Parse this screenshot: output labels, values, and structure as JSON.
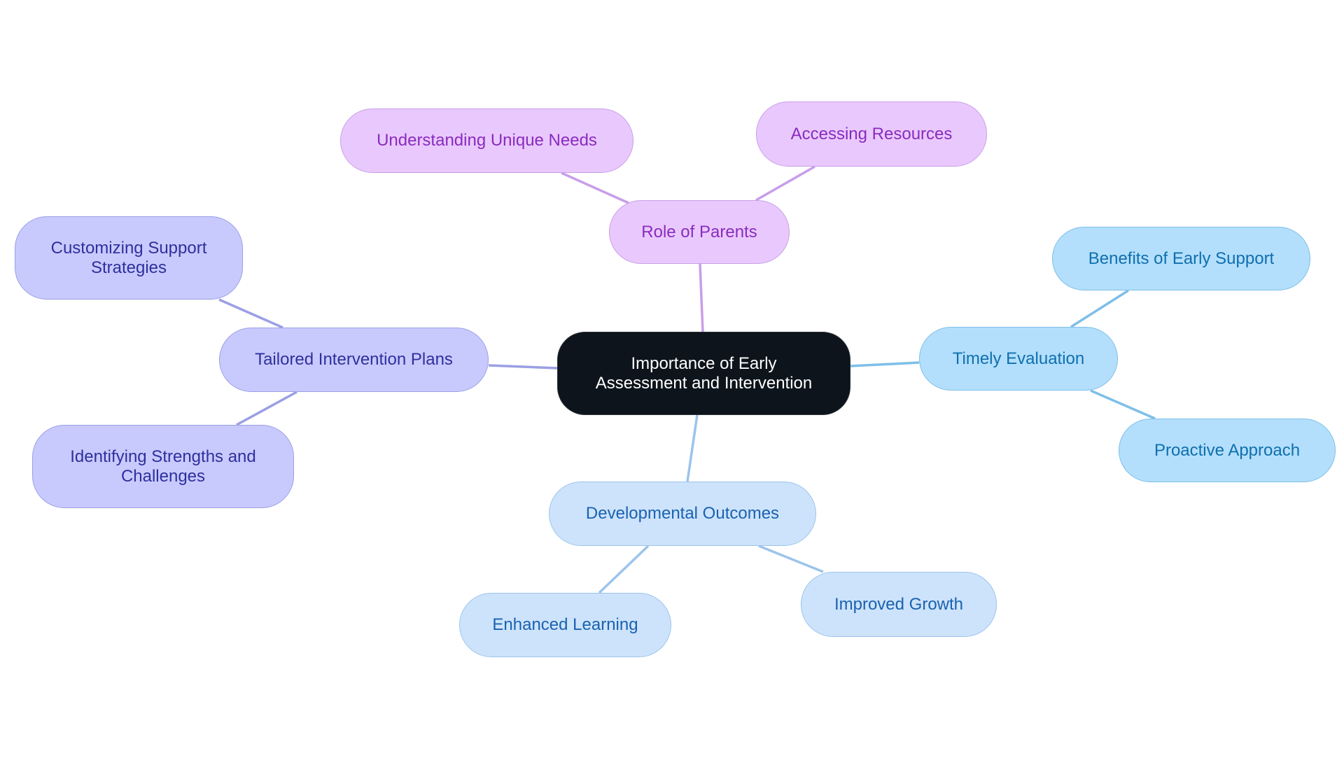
{
  "diagram": {
    "type": "mindmap",
    "root": {
      "id": "root",
      "label": "Importance of Early\nAssessment and Intervention",
      "colors": {
        "fill": "#0d141b",
        "border": "#2b3138",
        "text": "#ffffff"
      }
    },
    "branches": [
      {
        "id": "parents",
        "label": "Role of Parents",
        "colors": {
          "fill": "#e9c9fd",
          "border": "#c89ee9",
          "text": "#8a2bbf",
          "edge": "#c89ee9"
        },
        "children": [
          {
            "id": "unique-needs",
            "label": "Understanding Unique Needs"
          },
          {
            "id": "resources",
            "label": "Accessing Resources"
          }
        ]
      },
      {
        "id": "tailored",
        "label": "Tailored Intervention Plans",
        "colors": {
          "fill": "#c8cafd",
          "border": "#9a9fe4",
          "text": "#2f2f9e",
          "edge": "#9a9fe4"
        },
        "children": [
          {
            "id": "customizing",
            "label": "Customizing Support\nStrategies"
          },
          {
            "id": "strengths",
            "label": "Identifying Strengths and\nChallenges"
          }
        ]
      },
      {
        "id": "timely",
        "label": "Timely Evaluation",
        "colors": {
          "fill": "#b3dffc",
          "border": "#7ebfe8",
          "text": "#0f6fae",
          "edge": "#7ebfe8"
        },
        "children": [
          {
            "id": "benefits",
            "label": "Benefits of Early Support"
          },
          {
            "id": "proactive",
            "label": "Proactive Approach"
          }
        ]
      },
      {
        "id": "developmental",
        "label": "Developmental Outcomes",
        "colors": {
          "fill": "#cde3fb",
          "border": "#9cc4ec",
          "text": "#1a62b0",
          "edge": "#9cc4ec"
        },
        "children": [
          {
            "id": "enhanced",
            "label": "Enhanced Learning"
          },
          {
            "id": "improved",
            "label": "Improved Growth"
          }
        ]
      }
    ]
  }
}
